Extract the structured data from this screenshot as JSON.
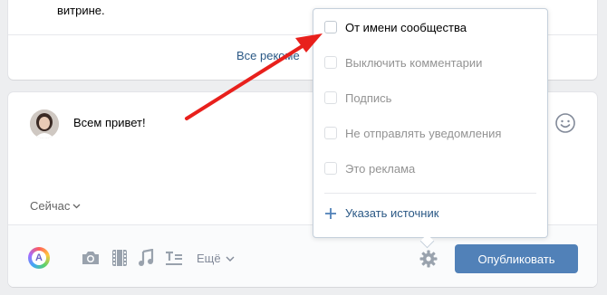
{
  "top_card": {
    "text": "витрине.",
    "recs_link": "Все рекоме"
  },
  "composer": {
    "post_text": "Всем привет!",
    "time_label": "Сейчас",
    "toolbar": {
      "avatar_letter": "A",
      "more_label": "Ещё",
      "publish_label": "Опубликовать"
    }
  },
  "settings_menu": {
    "options": [
      {
        "label": "От имени сообщества",
        "enabled": true,
        "checked": false
      },
      {
        "label": "Выключить комментарии",
        "enabled": false,
        "checked": false
      },
      {
        "label": "Подпись",
        "enabled": false,
        "checked": false
      },
      {
        "label": "Не отправлять уведомления",
        "enabled": false,
        "checked": false
      },
      {
        "label": "Это реклама",
        "enabled": false,
        "checked": false
      }
    ],
    "source_link": "Указать источник"
  },
  "colors": {
    "accent": "#5181b8",
    "link": "#2a5885",
    "annotation_arrow": "#e8201c"
  }
}
